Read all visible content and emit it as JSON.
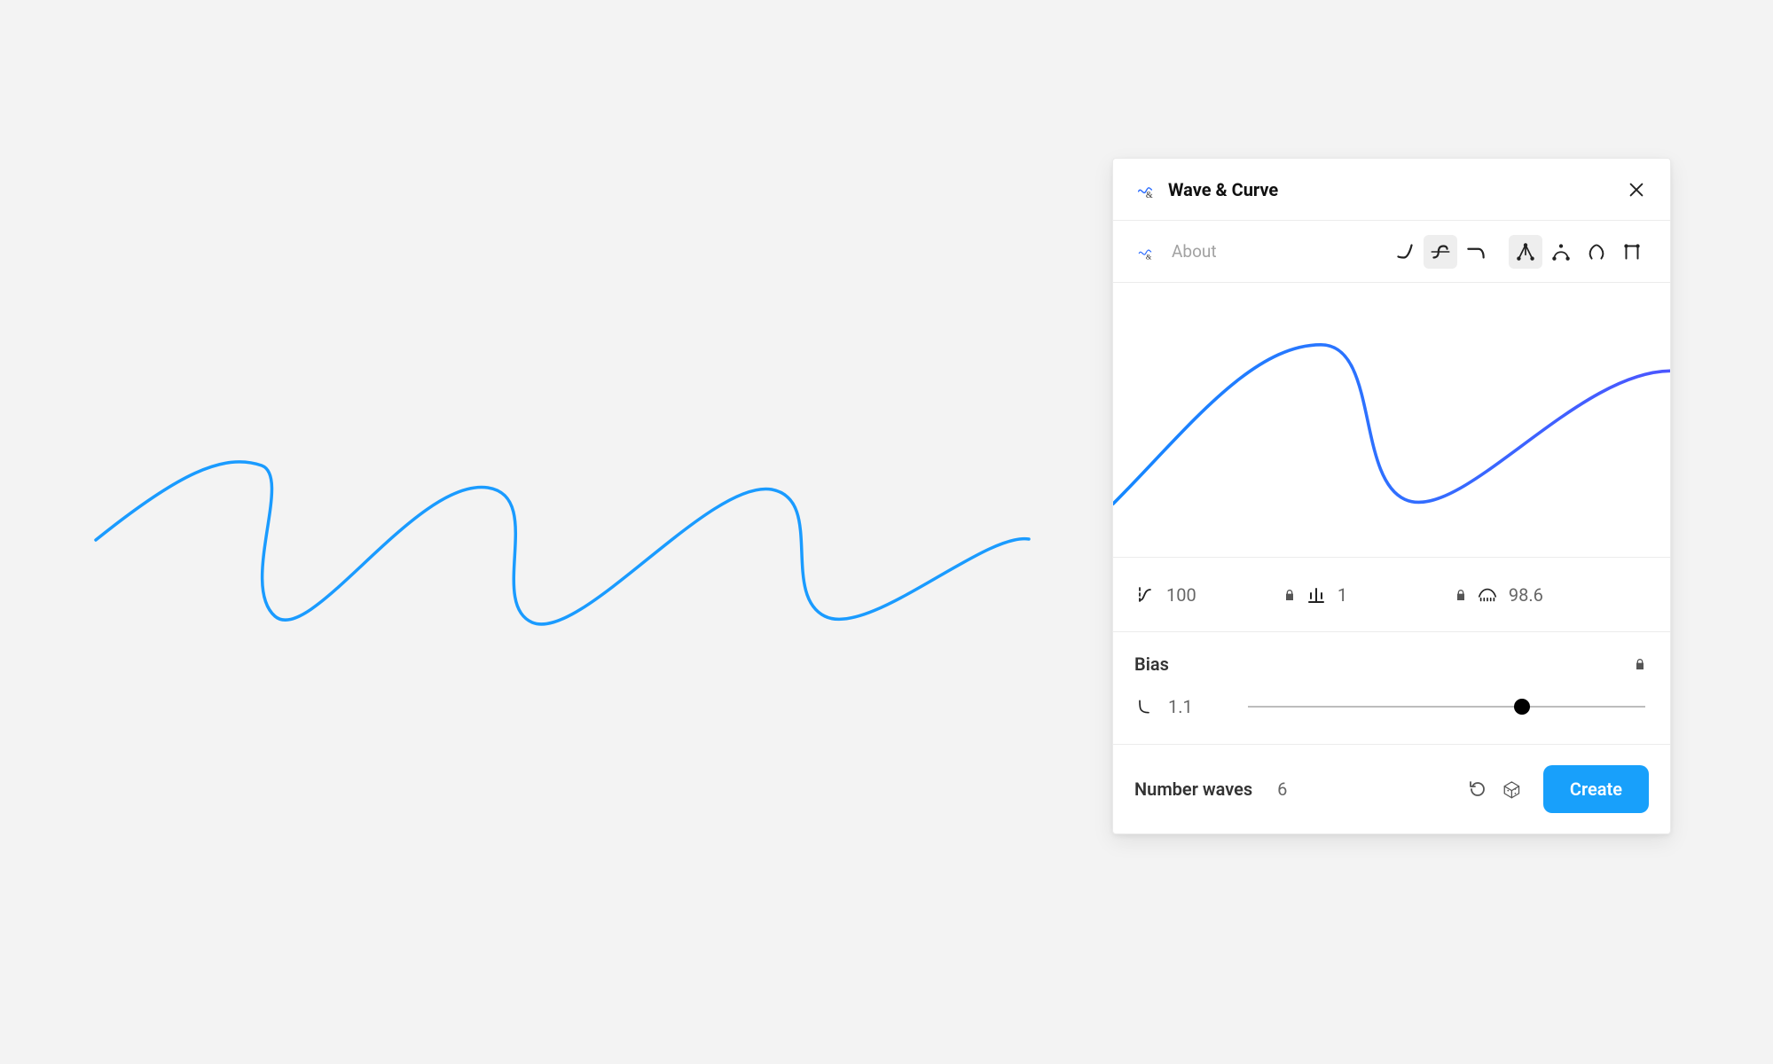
{
  "panel": {
    "title": "Wave & Curve",
    "about_label": "About",
    "curve_style_tools": [
      {
        "name": "curve-style-smooth",
        "selected": false
      },
      {
        "name": "curve-style-s",
        "selected": true
      },
      {
        "name": "curve-style-flat",
        "selected": false
      }
    ],
    "end_style_tools": [
      {
        "name": "end-style-triangle",
        "selected": true
      },
      {
        "name": "end-style-arc",
        "selected": false
      },
      {
        "name": "end-style-loop",
        "selected": false
      },
      {
        "name": "end-style-square",
        "selected": false
      }
    ],
    "params": {
      "amplitude": {
        "value": "100",
        "locked": true
      },
      "count": {
        "value": "1",
        "locked": true
      },
      "width": {
        "value": "98.6",
        "locked": false
      }
    },
    "bias": {
      "label": "Bias",
      "value": "1.1",
      "locked": true,
      "slider_percent": 69
    },
    "number_waves": {
      "label": "Number waves",
      "value": "6"
    },
    "create_label": "Create"
  },
  "colors": {
    "canvas_stroke": "#1a9bff",
    "preview_stroke_start": "#1488ff",
    "preview_stroke_end": "#4b56ff",
    "accent": "#18a0fb"
  }
}
